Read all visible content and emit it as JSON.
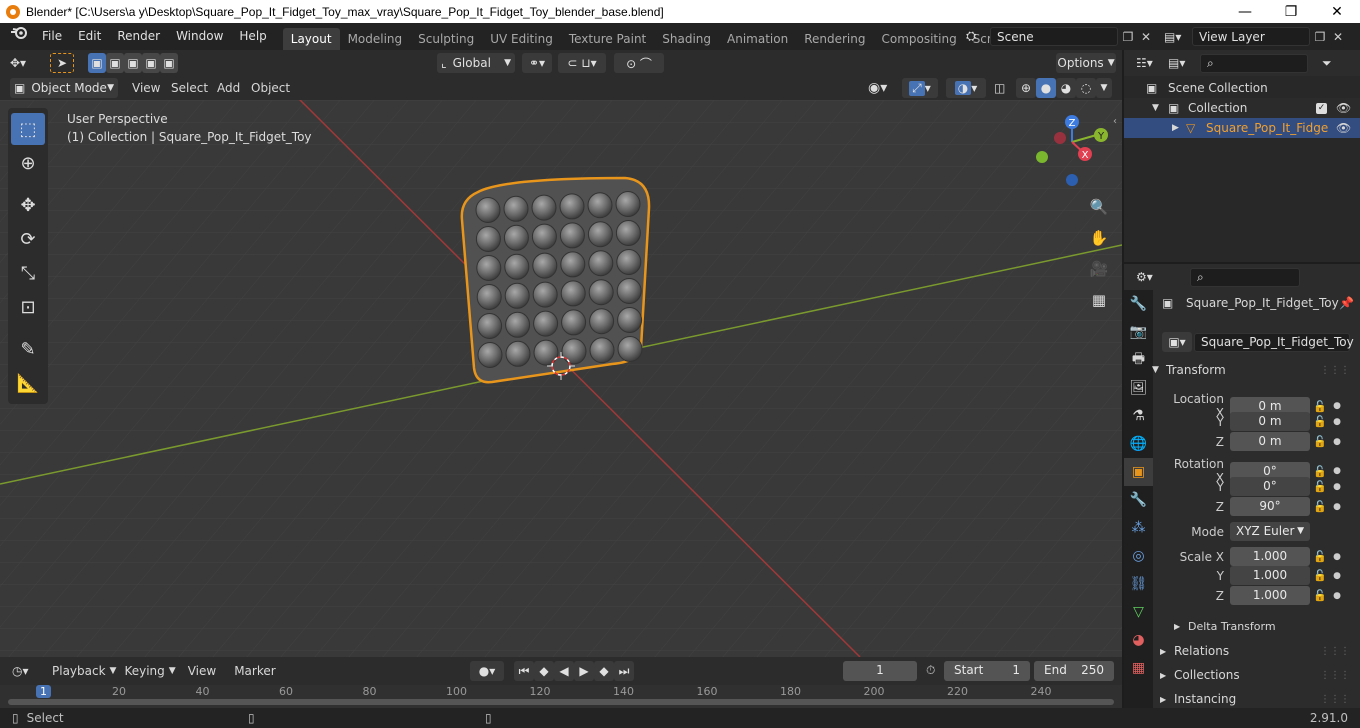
{
  "window": {
    "title": "Blender* [C:\\Users\\a y\\Desktop\\Square_Pop_It_Fidget_Toy_max_vray\\Square_Pop_It_Fidget_Toy_blender_base.blend]",
    "minimize": "—",
    "maximize": "❐",
    "close": "✕"
  },
  "menu": [
    "File",
    "Edit",
    "Render",
    "Window",
    "Help"
  ],
  "workspaces": [
    "Layout",
    "Modeling",
    "Sculpting",
    "UV Editing",
    "Texture Paint",
    "Shading",
    "Animation",
    "Rendering",
    "Compositing",
    "Scripting"
  ],
  "active_workspace": "Layout",
  "scene": {
    "name": "Scene",
    "view_layer": "View Layer"
  },
  "viewport_header": {
    "transform_orientation": "Global",
    "options": "Options",
    "mode": "Object Mode",
    "menus": [
      "View",
      "Select",
      "Add",
      "Object"
    ]
  },
  "viewport": {
    "perspective": "User Perspective",
    "collection_info": "(1) Collection | Square_Pop_It_Fidget_Toy",
    "axis_labels": {
      "x": "X",
      "y": "Y",
      "z": "Z"
    }
  },
  "outliner": {
    "scene_collection": "Scene Collection",
    "collection": "Collection",
    "object": "Square_Pop_It_Fidge"
  },
  "properties": {
    "object_name": "Square_Pop_It_Fidget_Toy",
    "data_name": "Square_Pop_It_Fidget_Toy",
    "transform": "Transform",
    "location_label": "Location X",
    "rotation_label": "Rotation X",
    "scale_label": "Scale X",
    "y": "Y",
    "z": "Z",
    "location": [
      "0 m",
      "0 m",
      "0 m"
    ],
    "rotation": [
      "0°",
      "0°",
      "90°"
    ],
    "mode_label": "Mode",
    "mode": "XYZ Euler",
    "scale": [
      "1.000",
      "1.000",
      "1.000"
    ],
    "delta_transform": "Delta Transform",
    "relations": "Relations",
    "collections": "Collections",
    "instancing": "Instancing"
  },
  "timeline": {
    "menus": [
      "Playback",
      "Keying",
      "View",
      "Marker"
    ],
    "current_frame": "1",
    "start_label": "Start",
    "start": "1",
    "end_label": "End",
    "end": "250",
    "ruler": [
      "1",
      "20",
      "40",
      "60",
      "80",
      "100",
      "120",
      "140",
      "160",
      "180",
      "200",
      "220",
      "240"
    ]
  },
  "status": {
    "select": "Select",
    "version": "2.91.0"
  },
  "colors": {
    "accent": "#4772b3",
    "selection": "#e8951c",
    "x_axis": "#c33b3b",
    "y_axis": "#8ab62e"
  }
}
